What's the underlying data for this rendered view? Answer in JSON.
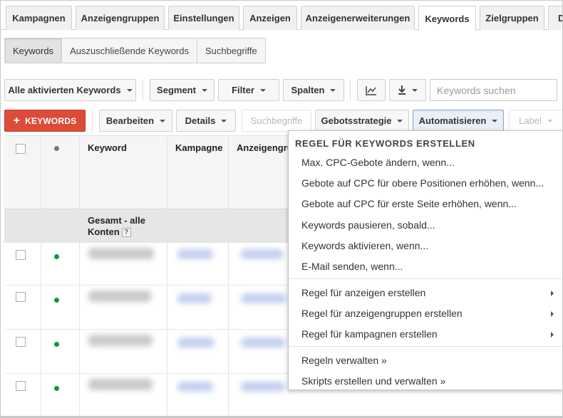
{
  "tabs": [
    "Kampagnen",
    "Anzeigengruppen",
    "Einstellungen",
    "Anzeigen",
    "Anzeigenerweiterungen",
    "Keywords",
    "Zielgruppen",
    "D"
  ],
  "active_tab": "Keywords",
  "subtabs": [
    "Keywords",
    "Auszuschließende Keywords",
    "Suchbegriffe"
  ],
  "toolbar1": {
    "filter_all": "Alle aktivierten Keywords",
    "segment": "Segment",
    "filter": "Filter",
    "columns": "Spalten",
    "chart_icon": "line-chart-icon",
    "download_icon": "download-icon",
    "search_placeholder": "Keywords suchen"
  },
  "toolbar2": {
    "add_plus": "+",
    "add": "KEYWORDS",
    "edit": "Bearbeiten",
    "details": "Details",
    "search_terms": "Suchbegriffe",
    "bid_strategy": "Gebotsstrategie",
    "automate": "Automatisieren",
    "label": "Label"
  },
  "table": {
    "headers": [
      "Keyword",
      "Kampagne",
      "Anzeigengrup"
    ],
    "total_label_1": "Gesamt - alle",
    "total_label_2": "Konten",
    "total_help": "?",
    "status_color": "#0b9a3e"
  },
  "menu": {
    "title": "REGEL FÜR KEYWORDS ERSTELLEN",
    "group1": [
      "Max. CPC-Gebote ändern, wenn...",
      "Gebote auf CPC für obere Positionen erhöhen, wenn...",
      "Gebote auf CPC für erste Seite erhöhen, wenn...",
      "Keywords pausieren, sobald...",
      "Keywords aktivieren, wenn...",
      "E-Mail senden, wenn..."
    ],
    "group2": [
      "Regel für anzeigen erstellen",
      "Regel für anzeigengruppen erstellen",
      "Regel für kampagnen erstellen"
    ],
    "group3": [
      "Regeln verwalten »",
      "Skripts erstellen und verwalten »"
    ]
  },
  "accent_red": "#dd4b39"
}
